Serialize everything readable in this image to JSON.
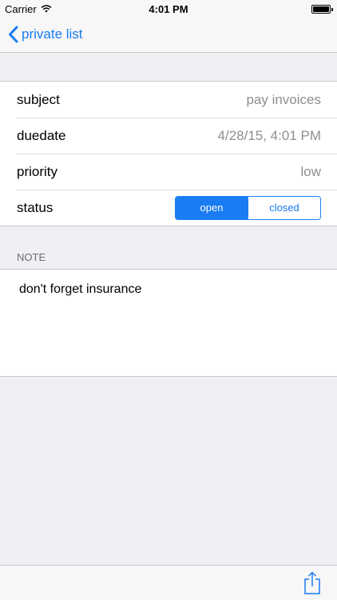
{
  "status_bar": {
    "carrier": "Carrier",
    "time": "4:01 PM",
    "icons": [
      "wifi-icon",
      "battery-icon"
    ]
  },
  "nav": {
    "back_label": "private list",
    "back_icon": "chevron-left-icon"
  },
  "fields": {
    "subject": {
      "label": "subject",
      "value": "pay invoices"
    },
    "duedate": {
      "label": "duedate",
      "value": "4/28/15, 4:01 PM"
    },
    "priority": {
      "label": "priority",
      "value": "low"
    },
    "status": {
      "label": "status",
      "options": [
        "open",
        "closed"
      ],
      "selected": "open"
    }
  },
  "note": {
    "header": "NOTE",
    "text": "don't forget insurance"
  },
  "toolbar": {
    "share_icon": "share-icon"
  },
  "colors": {
    "accent": "#1a7cf2",
    "background": "#efeff4",
    "secondary_text": "#8e8e93"
  }
}
